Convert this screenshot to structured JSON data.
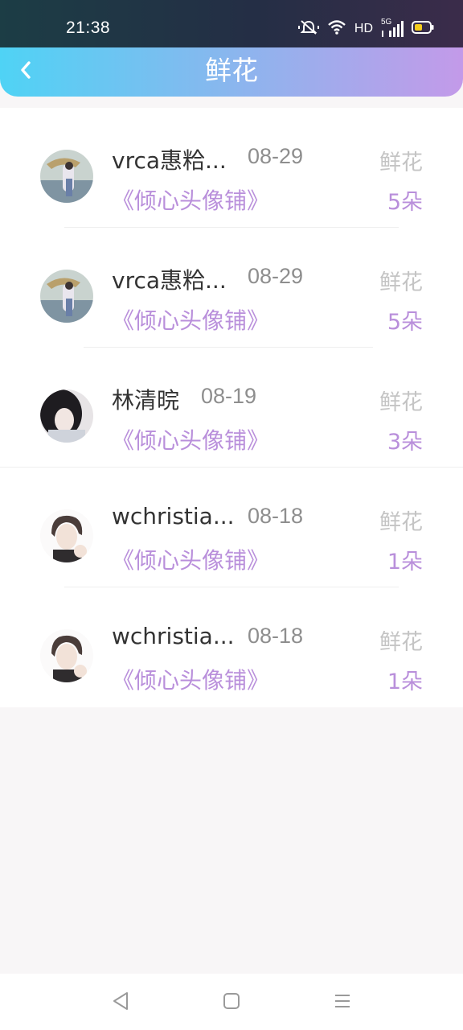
{
  "status_bar": {
    "time": "21:38",
    "network_label": "HD",
    "signal_label": "5G",
    "icons": [
      "mute-icon",
      "wifi-icon",
      "signal-icon",
      "battery-icon"
    ]
  },
  "nav": {
    "title": "鲜花",
    "back_icon": "chevron-left-icon"
  },
  "colors": {
    "accent_purple": "#b98fdb",
    "header_gradient_start": "#4fd3f5",
    "header_gradient_end": "#c39ae9"
  },
  "records": [
    {
      "user": "vrca惠粭...",
      "date": "08-29",
      "type": "鲜花",
      "shop": "《倾心头像铺》",
      "count": "5朵"
    },
    {
      "user": "vrca惠粭...",
      "date": "08-29",
      "type": "鲜花",
      "shop": "《倾心头像铺》",
      "count": "5朵"
    },
    {
      "user": "林清晥",
      "date": "08-19",
      "type": "鲜花",
      "shop": "《倾心头像铺》",
      "count": "3朵"
    },
    {
      "user": "wchristia...",
      "date": "08-18",
      "type": "鲜花",
      "shop": "《倾心头像铺》",
      "count": "1朵"
    },
    {
      "user": "wchristia...",
      "date": "08-18",
      "type": "鲜花",
      "shop": "《倾心头像铺》",
      "count": "1朵"
    }
  ],
  "system_nav": {
    "buttons": [
      "back-triangle-icon",
      "home-square-icon",
      "menu-lines-icon"
    ]
  }
}
